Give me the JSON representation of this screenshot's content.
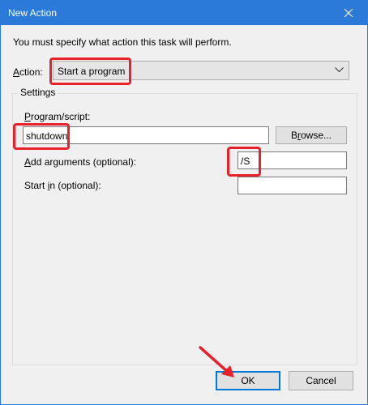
{
  "window": {
    "title": "New Action"
  },
  "instruction": "You must specify what action this task will perform.",
  "action": {
    "label_pre": "",
    "label_access": "A",
    "label_post": "ction:",
    "value": "Start a program"
  },
  "settings": {
    "title": "Settings",
    "program": {
      "label_access": "P",
      "label_post": "rogram/script:",
      "value": "shutdown"
    },
    "browse": {
      "label_pre": "B",
      "label_access": "r",
      "label_post": "owse..."
    },
    "arguments": {
      "label_access": "A",
      "label_post": "dd arguments (optional):",
      "value": "/S"
    },
    "start_in": {
      "label_pre": "Start ",
      "label_access": "i",
      "label_post": "n (optional):",
      "value": ""
    }
  },
  "buttons": {
    "ok": "OK",
    "cancel": "Cancel"
  },
  "colors": {
    "titlebar": "#2b79d8",
    "highlight": "#e8212a",
    "focus": "#0078d7"
  }
}
